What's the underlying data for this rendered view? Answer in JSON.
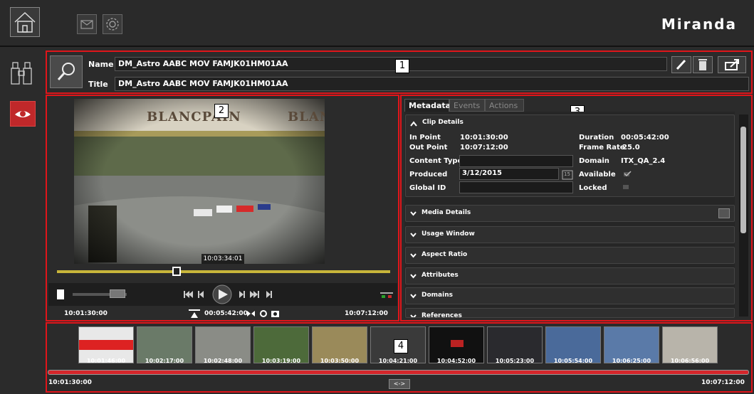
{
  "header": {
    "brand": "Miranda",
    "icons": [
      "home-icon",
      "mail-icon",
      "gear-icon"
    ]
  },
  "rail": {
    "icons": [
      "binoculars-icon",
      "eye-icon"
    ],
    "accent": "#c0282a"
  },
  "callouts": [
    "1",
    "2",
    "3",
    "4"
  ],
  "asset": {
    "name_label": "Name",
    "name_value": "DM_Astro AABC MOV  FAMJK01HM01AA",
    "title_label": "Title",
    "title_value": "DM_Astro AABC MOV  FAMJK01HM01AA",
    "actions": [
      "edit-icon",
      "trash-icon",
      "share-icon"
    ]
  },
  "player": {
    "overlay_tc": "10:03:34:01",
    "tc_in": "10:01:30:00",
    "duration": "00:05:42:00",
    "tc_out": "10:07:12:00",
    "scrub_position": 0.37,
    "volume": 0.7,
    "banner_text_1": "BLANCPAIN",
    "banner_text_2": "BLANCPAIN"
  },
  "metadata": {
    "tabs": [
      "Metadata",
      "Events",
      "Actions"
    ],
    "active_tab": "Metadata",
    "clip_details": {
      "title": "Clip Details",
      "in_point_label": "In Point",
      "in_point": "10:01:30:00",
      "out_point_label": "Out Point",
      "out_point": "10:07:12:00",
      "content_type_label": "Content Type",
      "content_type": "",
      "produced_label": "Produced",
      "produced": "3/12/2015",
      "global_id_label": "Global ID",
      "global_id": "",
      "duration_label": "Duration",
      "duration": "00:05:42:00",
      "frame_rate_label": "Frame Rate",
      "frame_rate": "25.0",
      "domain_label": "Domain",
      "domain": "ITX_QA_2.4",
      "available_label": "Available",
      "locked_label": "Locked",
      "calendar_day": "15"
    },
    "sections": [
      "Media Details",
      "Usage Window",
      "Aspect Ratio",
      "Attributes",
      "Domains",
      "References"
    ]
  },
  "filmstrip": {
    "thumbs": [
      "10:01:46:00",
      "10:02:17:00",
      "10:02:48:00",
      "10:03:19:00",
      "10:03:50:00",
      "10:04:21:00",
      "10:04:52:00",
      "10:05:23:00",
      "10:05:54:00",
      "10:06:25:00",
      "10:06:56:00"
    ],
    "start_tc": "10:01:30:00",
    "end_tc": "10:07:12:00",
    "swap_label": "<->"
  }
}
